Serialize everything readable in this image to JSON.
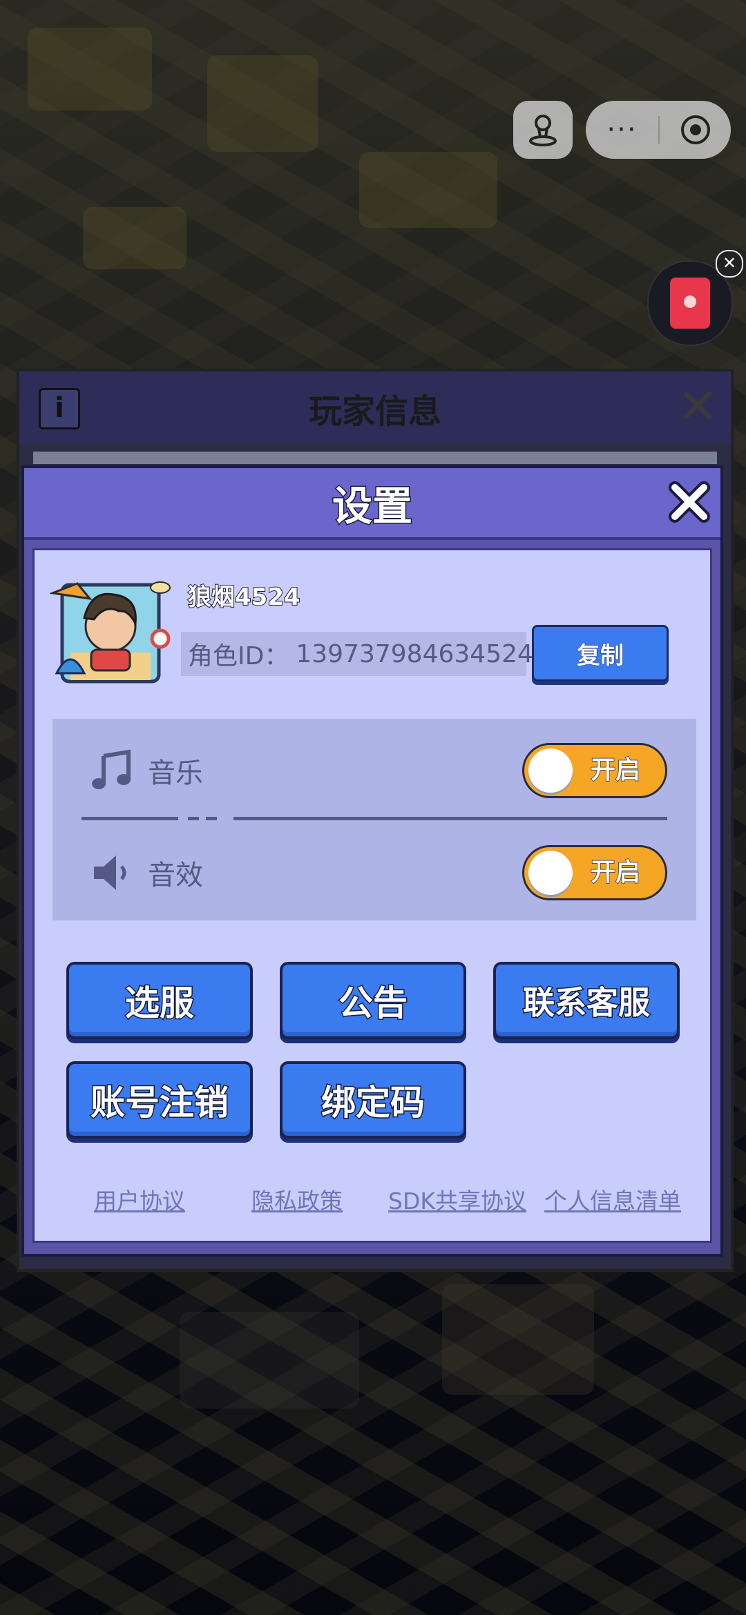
{
  "capsule": {
    "more_label": "···"
  },
  "player_info": {
    "title": "玩家信息"
  },
  "settings": {
    "title": "设置",
    "player_name": "狼烟4524",
    "role_id_label": "角色ID：",
    "role_id_value": "139737984634524",
    "copy_label": "复制",
    "music": {
      "label": "音乐",
      "toggle_label": "开启",
      "enabled": true
    },
    "sound": {
      "label": "音效",
      "toggle_label": "开启",
      "enabled": true
    },
    "buttons": [
      "选服",
      "公告",
      "联系客服",
      "账号注销",
      "绑定码"
    ],
    "links": [
      "用户协议",
      "隐私政策",
      "SDK共享协议",
      "个人信息清单"
    ]
  },
  "colors": {
    "accent_blue": "#3a7bf0",
    "toggle_on": "#f5a625",
    "header_purple": "#6b66cc",
    "panel_bg": "#c9cdfb"
  }
}
